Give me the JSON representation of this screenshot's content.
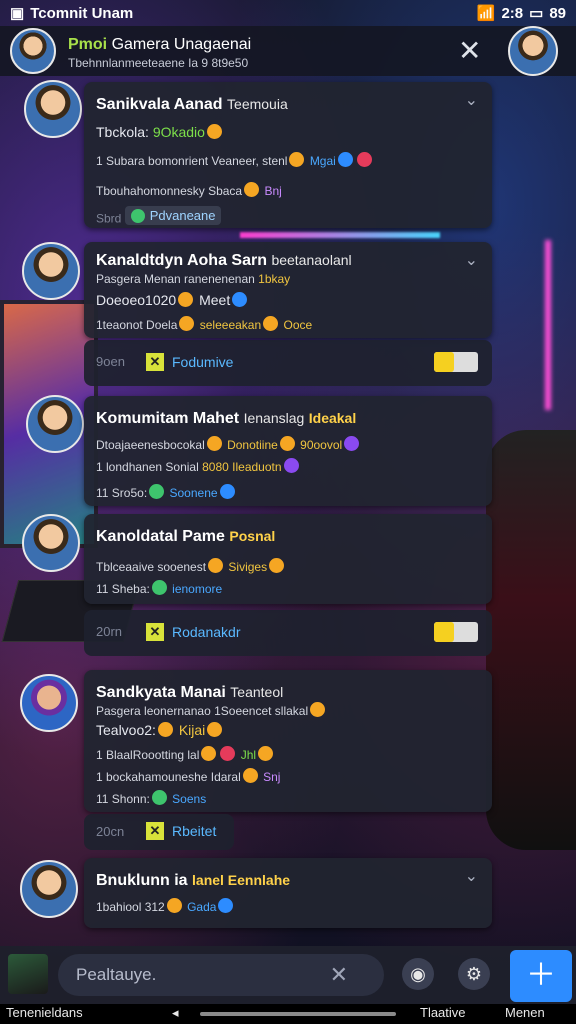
{
  "status": {
    "left_text": "Tcomnit Unam",
    "time": "2:8",
    "battery": "89"
  },
  "header": {
    "title_accent": "Pmoi",
    "title_rest": "Gamera Unagaenai",
    "subtitle": "Tbehnnlanmeeteaene Ia 9 8t9e50"
  },
  "cards": [
    {
      "name": "Sanikvala Aanad",
      "tag": "Teemouia",
      "line1_prefix": "Tbckola:",
      "line1_hl": "9Okadio",
      "line2": "1 Subara bomonrient Veaneer, stenl",
      "line2_hl": "Mgai",
      "line3": "Tbouhahomonnesky Sbaca",
      "line3_hl": "Bnj",
      "time": "Sbrd",
      "chip": "Pdvaneane"
    },
    {
      "name": "Kanaldtdyn Aoha Sarn",
      "tag": "beetanaolanl",
      "line1": "Pasgera Menan ranenenenan",
      "line1_hl": "1bkay",
      "line2": "Doeoeo1020",
      "line2_hl": "Meet",
      "line3": "1teaonot Doela",
      "line3_hl": "seleeeakan",
      "line3_end": "Ooce",
      "action_time": "9oen",
      "action_label": "Fodumive"
    },
    {
      "name": "Komumitam Mahet",
      "name_tail": "Ienanslag",
      "tag": "Ideakal",
      "line1": "Dtoajaeenesbocokal",
      "line1_hl": "Donotiine",
      "line1_end": "90oovol",
      "line2": "1 londhanen Sonial",
      "line2_hl": "8080 Ileaduotn",
      "line3_prefix": "11 Sro5o:",
      "line3_hl": "Soonene"
    },
    {
      "name": "Kanoldatal Pame",
      "tag": "Posnal",
      "line1": "Tblceaaive sooenest",
      "line1_hl": "Siviges",
      "line2_prefix": "11 Sheba:",
      "line2_hl": "ienomore",
      "action_time": "20rn",
      "action_label": "Rodanakdr"
    },
    {
      "name": "Sandkyata Manai",
      "tag": "Teanteol",
      "line1": "Pasgera leonernanao 1Soeencet sllakal",
      "line2": "Tealvoo2:",
      "line2_hl": "Kijai",
      "line3": "1 BlaalRoootting lal",
      "line3_hl": "Jhl",
      "line4": "1 bockahamouneshe Idaral",
      "line4_hl": "Snj",
      "line5_prefix": "11 Shonn:",
      "line5_hl": "Soens",
      "action_time": "20cn",
      "action_label": "Rbeitet"
    },
    {
      "name": "Bnuklunn ia",
      "tag": "lanel Eennlahe",
      "line1": "1bahiool 312",
      "line1_hl": "Gada"
    }
  ],
  "composer": {
    "placeholder": "Pealtauye."
  },
  "navbar": {
    "left": "Tenenieldans",
    "mid": "Tlaative",
    "right": "Menen"
  }
}
